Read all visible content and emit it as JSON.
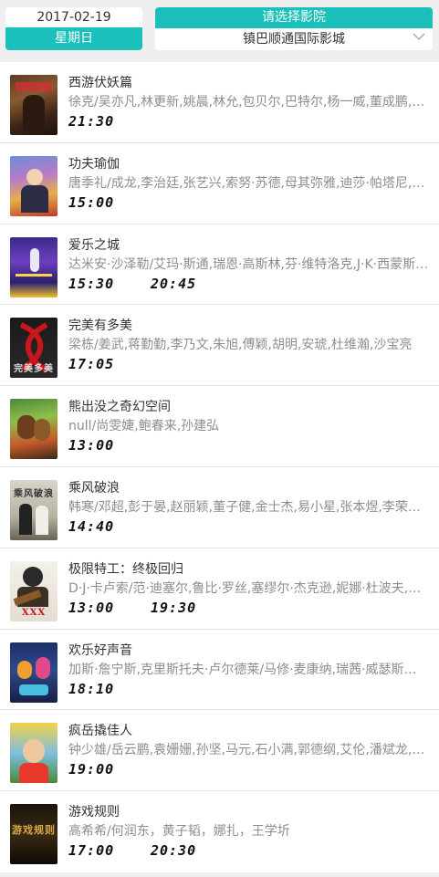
{
  "header": {
    "date": "2017-02-19",
    "weekday": "星期日",
    "cinema_label": "请选择影院",
    "cinema_selected": "镇巴顺通国际影城"
  },
  "colors": {
    "accent": "#1ac0b9",
    "background": "#efefef",
    "cast_text": "#8d8d8d"
  },
  "movies": [
    {
      "title": "西游伏妖篇",
      "cast": "徐克/吴亦凡,林更新,姚晨,林允,包贝尔,巴特尔,杨一威,董成鹏,王…",
      "times": [
        "21:30"
      ],
      "poster_text": ""
    },
    {
      "title": "功夫瑜伽",
      "cast": "唐季礼/成龙,李治廷,张艺兴,索努·苏德,母其弥雅,迪莎·帕塔尼,艾…",
      "times": [
        "15:00"
      ],
      "poster_text": ""
    },
    {
      "title": "爱乐之城",
      "cast": "达米安·沙泽勒/艾玛·斯通,瑞恩·高斯林,芬·维特洛克,J·K·西蒙斯,…",
      "times": [
        "15:30",
        "20:45"
      ],
      "poster_text": ""
    },
    {
      "title": "完美有多美",
      "cast": "梁栋/姜武,蒋勤勤,李乃文,朱旭,傅颖,胡明,安琥,杜维瀚,沙宝亮",
      "times": [
        "17:05"
      ],
      "poster_text": "完美多美"
    },
    {
      "title": "熊出没之奇幻空间",
      "cast": "null/尚雯婕,鲍春来,孙建弘",
      "times": [
        "13:00"
      ],
      "poster_text": ""
    },
    {
      "title": "乘风破浪",
      "cast": "韩寒/邓超,彭于晏,赵丽颖,董子健,金士杰,易小星,张本煜,李荣浩,…",
      "times": [
        "14:40"
      ],
      "poster_text": "乘风破浪"
    },
    {
      "title": "极限特工：终极回归",
      "cast": "D·J·卡卢索/范·迪塞尔,鲁比·罗丝,塞缪尔·杰克逊,妮娜·杜波夫,迪…",
      "times": [
        "13:00",
        "19:30"
      ],
      "poster_text": "XXX"
    },
    {
      "title": "欢乐好声音",
      "cast": "加斯·詹宁斯,克里斯托夫·卢尔德莱/马修·麦康纳,瑞茜·威瑟斯彭,…",
      "times": [
        "18:10"
      ],
      "poster_text": ""
    },
    {
      "title": "疯岳撬佳人",
      "cast": "钟少雄/岳云鹏,袁姗姗,孙坚,马元,石小满,郭德纲,艾伦,潘斌龙,杨能",
      "times": [
        "19:00"
      ],
      "poster_text": ""
    },
    {
      "title": "游戏规则",
      "cast": "高希希/何润东，黄子韬，娜扎，王学圻",
      "times": [
        "17:00",
        "20:30"
      ],
      "poster_text": "游戏规则"
    }
  ]
}
